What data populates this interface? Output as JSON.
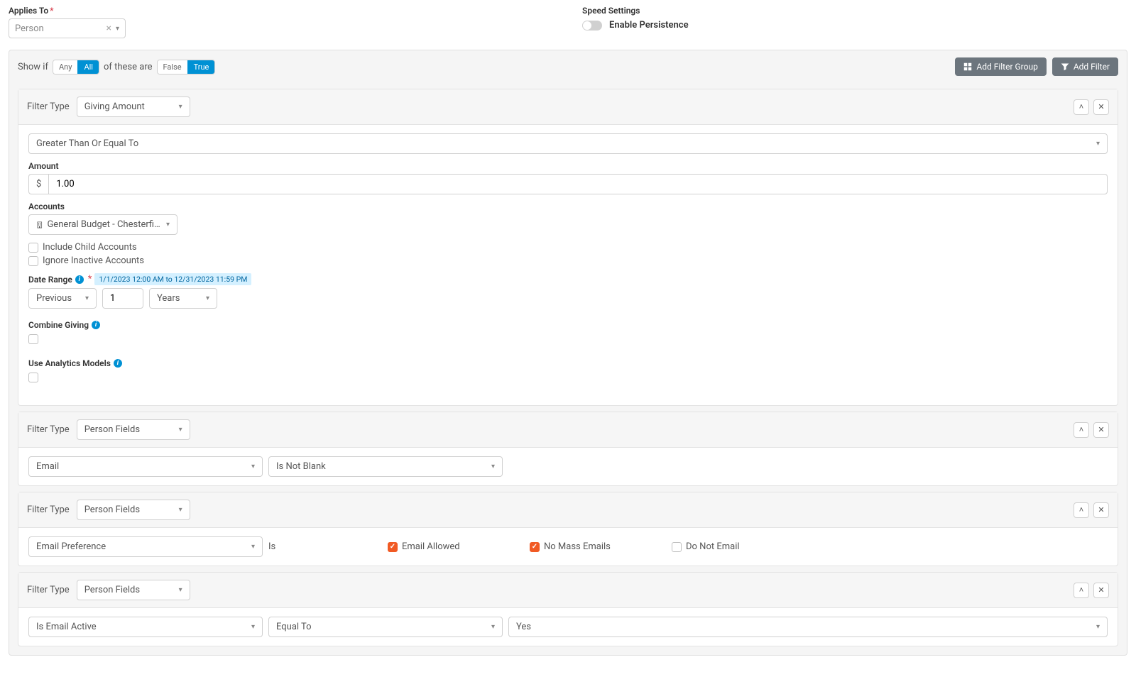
{
  "appliesTo": {
    "label": "Applies To",
    "value": "Person"
  },
  "speedSettings": {
    "label": "Speed Settings",
    "toggleLabel": "Enable Persistence"
  },
  "showIf": {
    "prefix": "Show if",
    "anyLabel": "Any",
    "allLabel": "All",
    "middle": "of these are",
    "falseLabel": "False",
    "trueLabel": "True"
  },
  "topButtons": {
    "addFilterGroup": "Add Filter Group",
    "addFilter": "Add Filter"
  },
  "filterTypeLabel": "Filter Type",
  "filter1": {
    "type": "Giving Amount",
    "comparison": "Greater Than Or Equal To",
    "amountLabel": "Amount",
    "amountPrefix": "$",
    "amountValue": "1.00",
    "accountsLabel": "Accounts",
    "accountsValue": "General Budget - Chesterfield Atte...",
    "includeChildAccounts": "Include Child Accounts",
    "ignoreInactiveAccounts": "Ignore Inactive Accounts",
    "dateRangeLabel": "Date Range",
    "dateRangeBadge": "1/1/2023 12:00 AM to 12/31/2023 11:59 PM",
    "dateRangePrevious": "Previous",
    "dateRangeNumber": "1",
    "dateRangeUnit": "Years",
    "combineGivingLabel": "Combine Giving",
    "useAnalyticsLabel": "Use Analytics Models"
  },
  "filter2": {
    "type": "Person Fields",
    "field": "Email",
    "condition": "Is Not Blank"
  },
  "filter3": {
    "type": "Person Fields",
    "field": "Email Preference",
    "condition": "Is",
    "options": {
      "emailAllowed": "Email Allowed",
      "noMassEmails": "No Mass Emails",
      "doNotEmail": "Do Not Email"
    }
  },
  "filter4": {
    "type": "Person Fields",
    "field": "Is Email Active",
    "condition": "Equal To",
    "value": "Yes"
  }
}
